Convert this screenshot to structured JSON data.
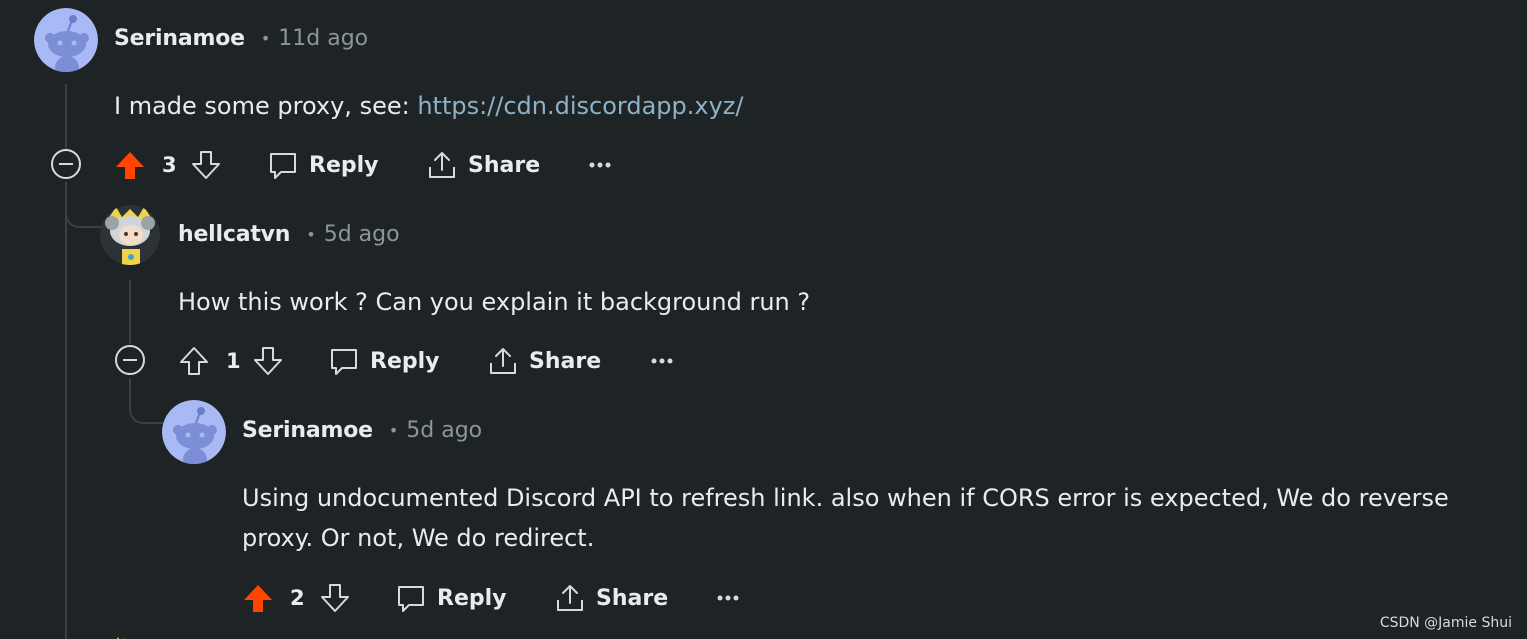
{
  "comments": [
    {
      "author": "Serinamoe",
      "age": "11d ago",
      "avatar": "snoo-avatar",
      "body_text": "I made some proxy, see: ",
      "body_link": "https://cdn.discordapp.xyz/",
      "score": "3",
      "upvoted": true,
      "reply_label": "Reply",
      "share_label": "Share"
    },
    {
      "author": "hellcatvn",
      "age": "5d ago",
      "avatar": "custom-cat-avatar",
      "body_text": "How this work ? Can you explain it background run ?",
      "score": "1",
      "upvoted": false,
      "reply_label": "Reply",
      "share_label": "Share"
    },
    {
      "author": "Serinamoe",
      "age": "5d ago",
      "avatar": "snoo-avatar",
      "body_text": "Using undocumented Discord API to refresh link. also when if CORS error is expected, We do reverse proxy. Or not, We do redirect.",
      "score": "2",
      "upvoted": true,
      "reply_label": "Reply",
      "share_label": "Share"
    }
  ],
  "dot": "•",
  "watermark": "CSDN @Jamie Shui",
  "colors": {
    "background": "#1e2326",
    "upvote_active": "#ff4500",
    "link": "#8fb1c7",
    "muted": "#8b959b",
    "thread_line": "#3a4145"
  }
}
